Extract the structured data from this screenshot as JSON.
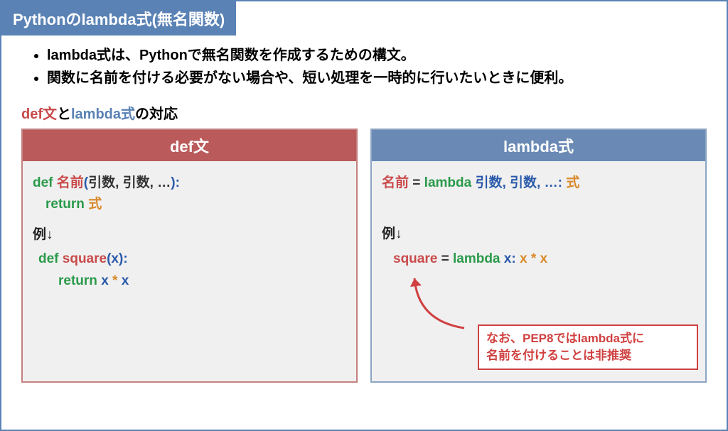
{
  "header": "Pythonのlambda式(無名関数)",
  "bullets": [
    "lambda式は、Pythonで無名関数を作成するための構文。",
    "関数に名前を付ける必要がない場合や、短い処理を一時的に行いたいときに便利。"
  ],
  "subtitle": {
    "part1": "def文",
    "part2": "と",
    "part3": "lambda式",
    "part4": "の対応"
  },
  "defBox": {
    "title": "def文",
    "syntax": {
      "def": "def ",
      "name": "名前",
      "lparen": "(",
      "args": "引数, 引数, …",
      "rparen": ")",
      "colon": ":",
      "ret": "return ",
      "expr": "式"
    },
    "exampleLabel": "例↓",
    "example": {
      "def": "def ",
      "name": "square",
      "lparen": "(",
      "x": "x",
      "rparen": ")",
      "colon": ":",
      "ret": "return ",
      "x1": "x ",
      "star": "* ",
      "x2": "x"
    }
  },
  "lambdaBox": {
    "title": "lambda式",
    "syntax": {
      "name": "名前",
      "eq": " = ",
      "lambda": "lambda ",
      "args": "引数, 引数, …",
      "colon": ": ",
      "expr": "式"
    },
    "exampleLabel": "例↓",
    "example": {
      "name": "square",
      "eq": " = ",
      "lambda": "lambda ",
      "x": "x",
      "colon": ": ",
      "x1": "x ",
      "star": "* ",
      "x2": "x"
    },
    "noteLine1": "なお、PEP8ではlambda式に",
    "noteLine2": "名前を付けることは非推奨"
  }
}
